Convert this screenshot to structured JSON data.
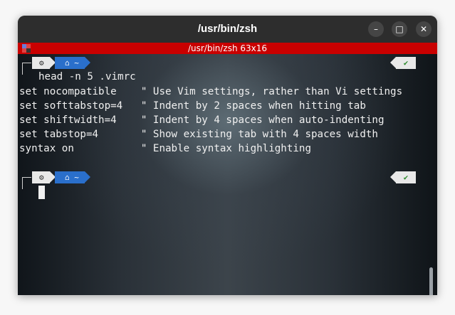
{
  "window": {
    "title": "/usr/bin/zsh",
    "minimize_glyph": "–",
    "maximize_glyph": "□",
    "close_glyph": "✕"
  },
  "tmux": {
    "status": "/usr/bin/zsh 63x16"
  },
  "prompt": {
    "os_glyph": "⚙",
    "home_glyph": "⌂",
    "dir": "~",
    "ok_glyph": "✔"
  },
  "terminal": {
    "command": "head -n 5 .vimrc",
    "output": [
      "set nocompatible    \" Use Vim settings, rather than Vi settings",
      "set softtabstop=4   \" Indent by 2 spaces when hitting tab",
      "set shiftwidth=4    \" Indent by 4 spaces when auto-indenting",
      "set tabstop=4       \" Show existing tab with 4 spaces width",
      "syntax on           \" Enable syntax highlighting"
    ]
  },
  "colors": {
    "tmux_bar": "#c90000",
    "dir_segment": "#2a6fcb",
    "ok_check": "#2e8b2e"
  }
}
